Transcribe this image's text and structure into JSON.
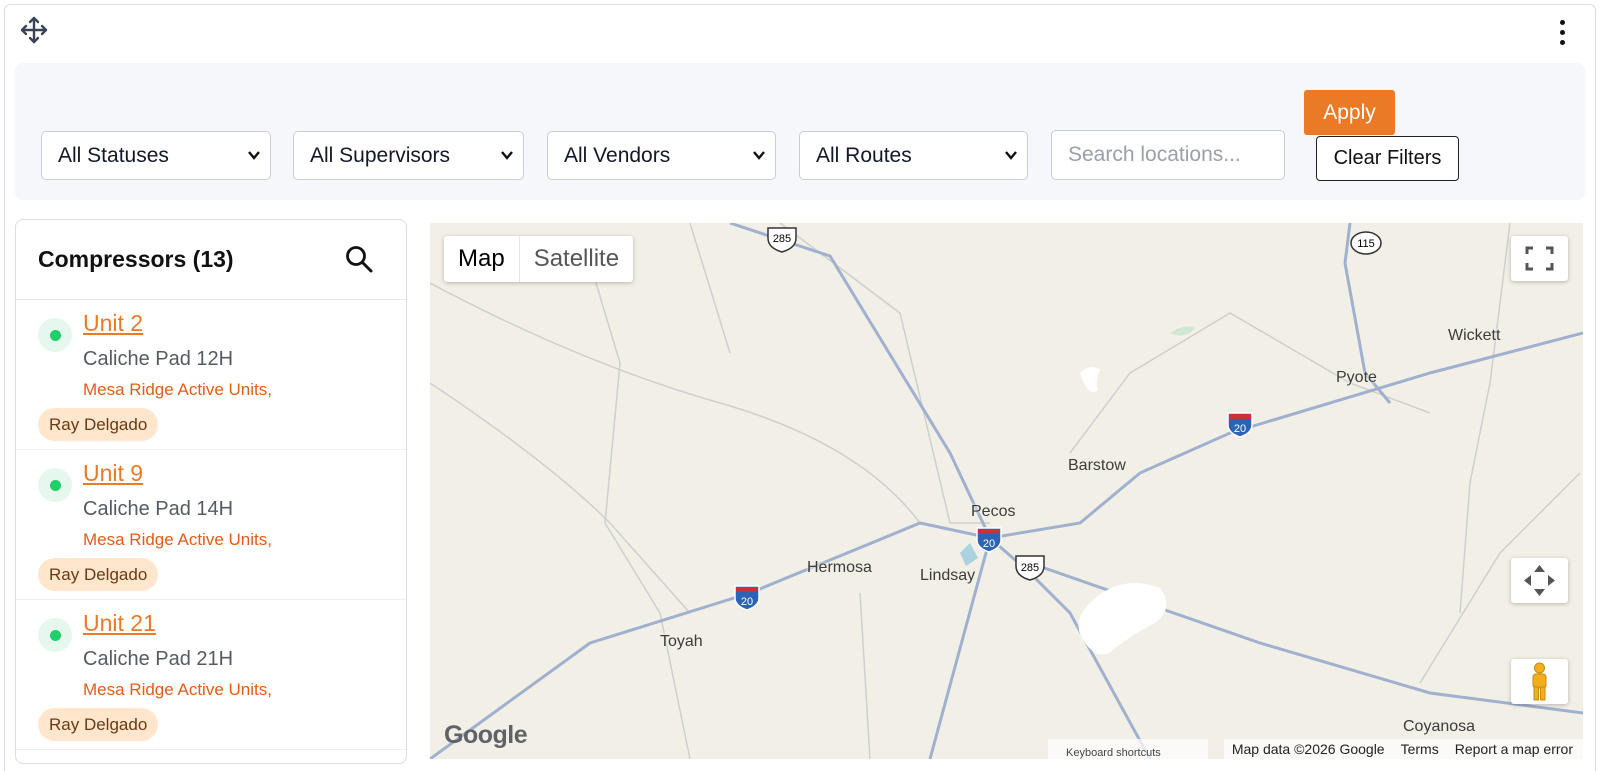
{
  "filters": {
    "status": "All Statuses",
    "supervisors": "All Supervisors",
    "vendors": "All Vendors",
    "routes": "All Routes",
    "search_placeholder": "Search locations...",
    "apply_label": "Apply",
    "clear_label": "Clear Filters"
  },
  "list": {
    "title": "Compressors (13)",
    "items": [
      {
        "name": "Unit 2",
        "location": "Caliche Pad 12H",
        "route": "Mesa Ridge Active Units,",
        "supervisor": "Ray Delgado",
        "status_color": "#1fcf6a"
      },
      {
        "name": "Unit 9",
        "location": "Caliche Pad 14H",
        "route": "Mesa Ridge Active Units,",
        "supervisor": "Ray Delgado",
        "status_color": "#1fcf6a"
      },
      {
        "name": "Unit 21",
        "location": "Caliche Pad 21H",
        "route": "Mesa Ridge Active Units,",
        "supervisor": "Ray Delgado",
        "status_color": "#1fcf6a"
      }
    ]
  },
  "map": {
    "type_map": "Map",
    "type_satellite": "Satellite",
    "places": [
      "Wickett",
      "Pyote",
      "Barstow",
      "Pecos",
      "Hermosa",
      "Lindsay",
      "Toyah",
      "Coyanosa"
    ],
    "shields": [
      "285",
      "115",
      "20",
      "20",
      "285",
      "20"
    ],
    "logo": "Google",
    "keyboard_shortcuts": "Keyboard shortcuts",
    "map_data": "Map data ©2026 Google",
    "terms": "Terms",
    "report": "Report a map error"
  },
  "colors": {
    "accent": "#ea7a26",
    "route_text": "#e35d14",
    "tag_bg": "#ffe6cc",
    "status_green": "#1fcf6a"
  },
  "icons": [
    "move-icon",
    "kebab-menu-icon",
    "chevron-down-icon",
    "search-icon",
    "fullscreen-icon",
    "camera-control-icon",
    "pegman-icon"
  ]
}
